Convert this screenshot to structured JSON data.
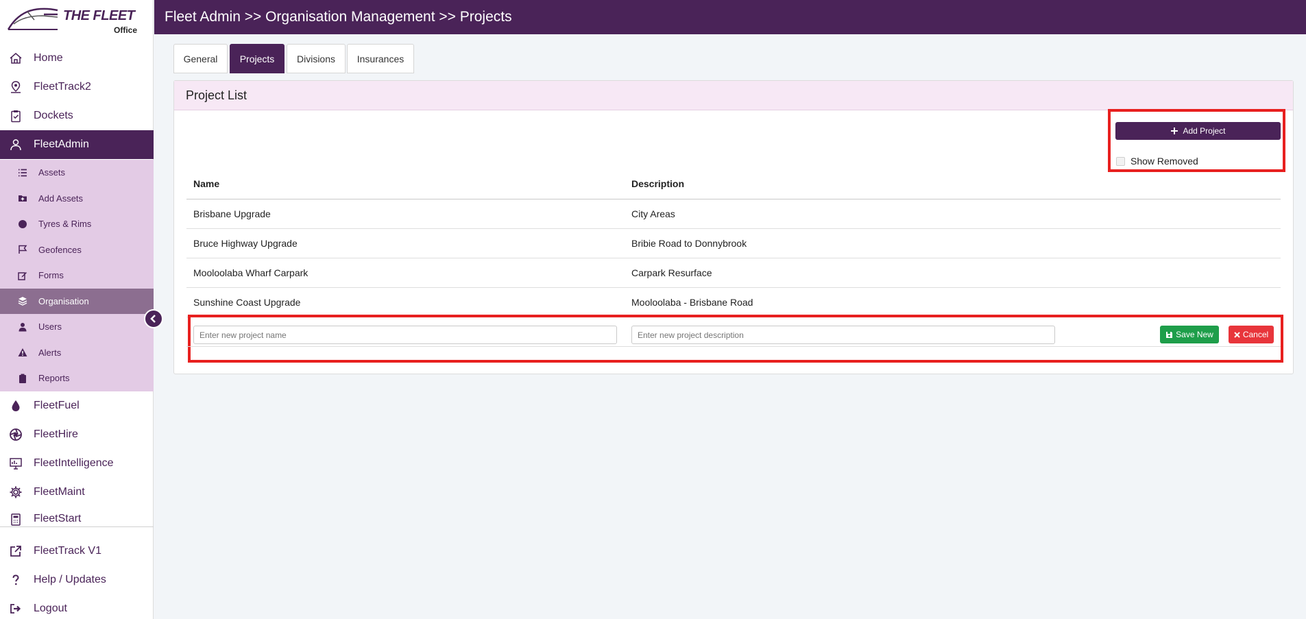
{
  "logo": {
    "text": "THE FLEET",
    "sub": "Office"
  },
  "sidebar": {
    "items": [
      {
        "label": "Home",
        "icon": "home-icon"
      },
      {
        "label": "FleetTrack2",
        "icon": "map-pin-icon"
      },
      {
        "label": "Dockets",
        "icon": "clipboard-check-icon"
      },
      {
        "label": "FleetAdmin",
        "icon": "user-admin-icon"
      }
    ],
    "subitems": [
      {
        "label": "Assets",
        "icon": "list-icon"
      },
      {
        "label": "Add Assets",
        "icon": "folder-plus-icon"
      },
      {
        "label": "Tyres & Rims",
        "icon": "circle-icon"
      },
      {
        "label": "Geofences",
        "icon": "flag-icon"
      },
      {
        "label": "Forms",
        "icon": "edit-icon"
      },
      {
        "label": "Organisation",
        "icon": "layers-icon"
      },
      {
        "label": "Users",
        "icon": "user-icon"
      },
      {
        "label": "Alerts",
        "icon": "warning-icon"
      },
      {
        "label": "Reports",
        "icon": "clipboard-icon"
      }
    ],
    "items2": [
      {
        "label": "FleetFuel",
        "icon": "fuel-drop-icon"
      },
      {
        "label": "FleetHire",
        "icon": "aperture-icon"
      },
      {
        "label": "FleetIntelligence",
        "icon": "presentation-icon"
      },
      {
        "label": "FleetMaint",
        "icon": "cog-icon"
      },
      {
        "label": "FleetStart",
        "icon": "calculator-icon"
      }
    ],
    "bottom": [
      {
        "label": "FleetTrack V1",
        "icon": "external-link-icon"
      },
      {
        "label": "Help / Updates",
        "icon": "question-icon"
      },
      {
        "label": "Logout",
        "icon": "logout-icon"
      }
    ]
  },
  "header": {
    "breadcrumb": "Fleet Admin >> Organisation Management >> Projects"
  },
  "tabs": [
    "General",
    "Projects",
    "Divisions",
    "Insurances"
  ],
  "panel": {
    "title": "Project List",
    "add_label": "Add Project",
    "show_removed": "Show Removed",
    "columns": [
      "Name",
      "Description"
    ],
    "rows": [
      {
        "name": "Brisbane Upgrade",
        "description": "City Areas"
      },
      {
        "name": "Bruce Highway Upgrade",
        "description": "Bribie Road to Donnybrook"
      },
      {
        "name": "Mooloolaba Wharf Carpark",
        "description": "Carpark Resurface"
      },
      {
        "name": "Sunshine Coast Upgrade",
        "description": "Mooloolaba - Brisbane Road"
      }
    ],
    "new_name_placeholder": "Enter new project name",
    "new_desc_placeholder": "Enter new project description",
    "save_label": "Save New",
    "cancel_label": "Cancel"
  },
  "colors": {
    "brand": "#4a2358",
    "submenu": "#e3cbe5",
    "success": "#1e9e4a",
    "danger": "#e8353b",
    "highlight": "#e8201f"
  }
}
